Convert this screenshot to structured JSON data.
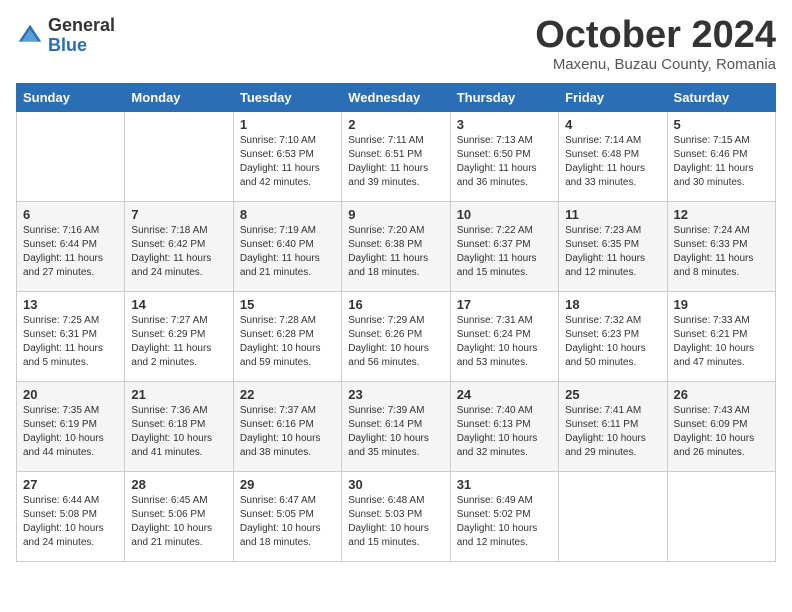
{
  "header": {
    "logo_general": "General",
    "logo_blue": "Blue",
    "month_title": "October 2024",
    "location": "Maxenu, Buzau County, Romania"
  },
  "days_of_week": [
    "Sunday",
    "Monday",
    "Tuesday",
    "Wednesday",
    "Thursday",
    "Friday",
    "Saturday"
  ],
  "weeks": [
    [
      {
        "day": "",
        "info": ""
      },
      {
        "day": "",
        "info": ""
      },
      {
        "day": "1",
        "info": "Sunrise: 7:10 AM\nSunset: 6:53 PM\nDaylight: 11 hours and 42 minutes."
      },
      {
        "day": "2",
        "info": "Sunrise: 7:11 AM\nSunset: 6:51 PM\nDaylight: 11 hours and 39 minutes."
      },
      {
        "day": "3",
        "info": "Sunrise: 7:13 AM\nSunset: 6:50 PM\nDaylight: 11 hours and 36 minutes."
      },
      {
        "day": "4",
        "info": "Sunrise: 7:14 AM\nSunset: 6:48 PM\nDaylight: 11 hours and 33 minutes."
      },
      {
        "day": "5",
        "info": "Sunrise: 7:15 AM\nSunset: 6:46 PM\nDaylight: 11 hours and 30 minutes."
      }
    ],
    [
      {
        "day": "6",
        "info": "Sunrise: 7:16 AM\nSunset: 6:44 PM\nDaylight: 11 hours and 27 minutes."
      },
      {
        "day": "7",
        "info": "Sunrise: 7:18 AM\nSunset: 6:42 PM\nDaylight: 11 hours and 24 minutes."
      },
      {
        "day": "8",
        "info": "Sunrise: 7:19 AM\nSunset: 6:40 PM\nDaylight: 11 hours and 21 minutes."
      },
      {
        "day": "9",
        "info": "Sunrise: 7:20 AM\nSunset: 6:38 PM\nDaylight: 11 hours and 18 minutes."
      },
      {
        "day": "10",
        "info": "Sunrise: 7:22 AM\nSunset: 6:37 PM\nDaylight: 11 hours and 15 minutes."
      },
      {
        "day": "11",
        "info": "Sunrise: 7:23 AM\nSunset: 6:35 PM\nDaylight: 11 hours and 12 minutes."
      },
      {
        "day": "12",
        "info": "Sunrise: 7:24 AM\nSunset: 6:33 PM\nDaylight: 11 hours and 8 minutes."
      }
    ],
    [
      {
        "day": "13",
        "info": "Sunrise: 7:25 AM\nSunset: 6:31 PM\nDaylight: 11 hours and 5 minutes."
      },
      {
        "day": "14",
        "info": "Sunrise: 7:27 AM\nSunset: 6:29 PM\nDaylight: 11 hours and 2 minutes."
      },
      {
        "day": "15",
        "info": "Sunrise: 7:28 AM\nSunset: 6:28 PM\nDaylight: 10 hours and 59 minutes."
      },
      {
        "day": "16",
        "info": "Sunrise: 7:29 AM\nSunset: 6:26 PM\nDaylight: 10 hours and 56 minutes."
      },
      {
        "day": "17",
        "info": "Sunrise: 7:31 AM\nSunset: 6:24 PM\nDaylight: 10 hours and 53 minutes."
      },
      {
        "day": "18",
        "info": "Sunrise: 7:32 AM\nSunset: 6:23 PM\nDaylight: 10 hours and 50 minutes."
      },
      {
        "day": "19",
        "info": "Sunrise: 7:33 AM\nSunset: 6:21 PM\nDaylight: 10 hours and 47 minutes."
      }
    ],
    [
      {
        "day": "20",
        "info": "Sunrise: 7:35 AM\nSunset: 6:19 PM\nDaylight: 10 hours and 44 minutes."
      },
      {
        "day": "21",
        "info": "Sunrise: 7:36 AM\nSunset: 6:18 PM\nDaylight: 10 hours and 41 minutes."
      },
      {
        "day": "22",
        "info": "Sunrise: 7:37 AM\nSunset: 6:16 PM\nDaylight: 10 hours and 38 minutes."
      },
      {
        "day": "23",
        "info": "Sunrise: 7:39 AM\nSunset: 6:14 PM\nDaylight: 10 hours and 35 minutes."
      },
      {
        "day": "24",
        "info": "Sunrise: 7:40 AM\nSunset: 6:13 PM\nDaylight: 10 hours and 32 minutes."
      },
      {
        "day": "25",
        "info": "Sunrise: 7:41 AM\nSunset: 6:11 PM\nDaylight: 10 hours and 29 minutes."
      },
      {
        "day": "26",
        "info": "Sunrise: 7:43 AM\nSunset: 6:09 PM\nDaylight: 10 hours and 26 minutes."
      }
    ],
    [
      {
        "day": "27",
        "info": "Sunrise: 6:44 AM\nSunset: 5:08 PM\nDaylight: 10 hours and 24 minutes."
      },
      {
        "day": "28",
        "info": "Sunrise: 6:45 AM\nSunset: 5:06 PM\nDaylight: 10 hours and 21 minutes."
      },
      {
        "day": "29",
        "info": "Sunrise: 6:47 AM\nSunset: 5:05 PM\nDaylight: 10 hours and 18 minutes."
      },
      {
        "day": "30",
        "info": "Sunrise: 6:48 AM\nSunset: 5:03 PM\nDaylight: 10 hours and 15 minutes."
      },
      {
        "day": "31",
        "info": "Sunrise: 6:49 AM\nSunset: 5:02 PM\nDaylight: 10 hours and 12 minutes."
      },
      {
        "day": "",
        "info": ""
      },
      {
        "day": "",
        "info": ""
      }
    ]
  ]
}
